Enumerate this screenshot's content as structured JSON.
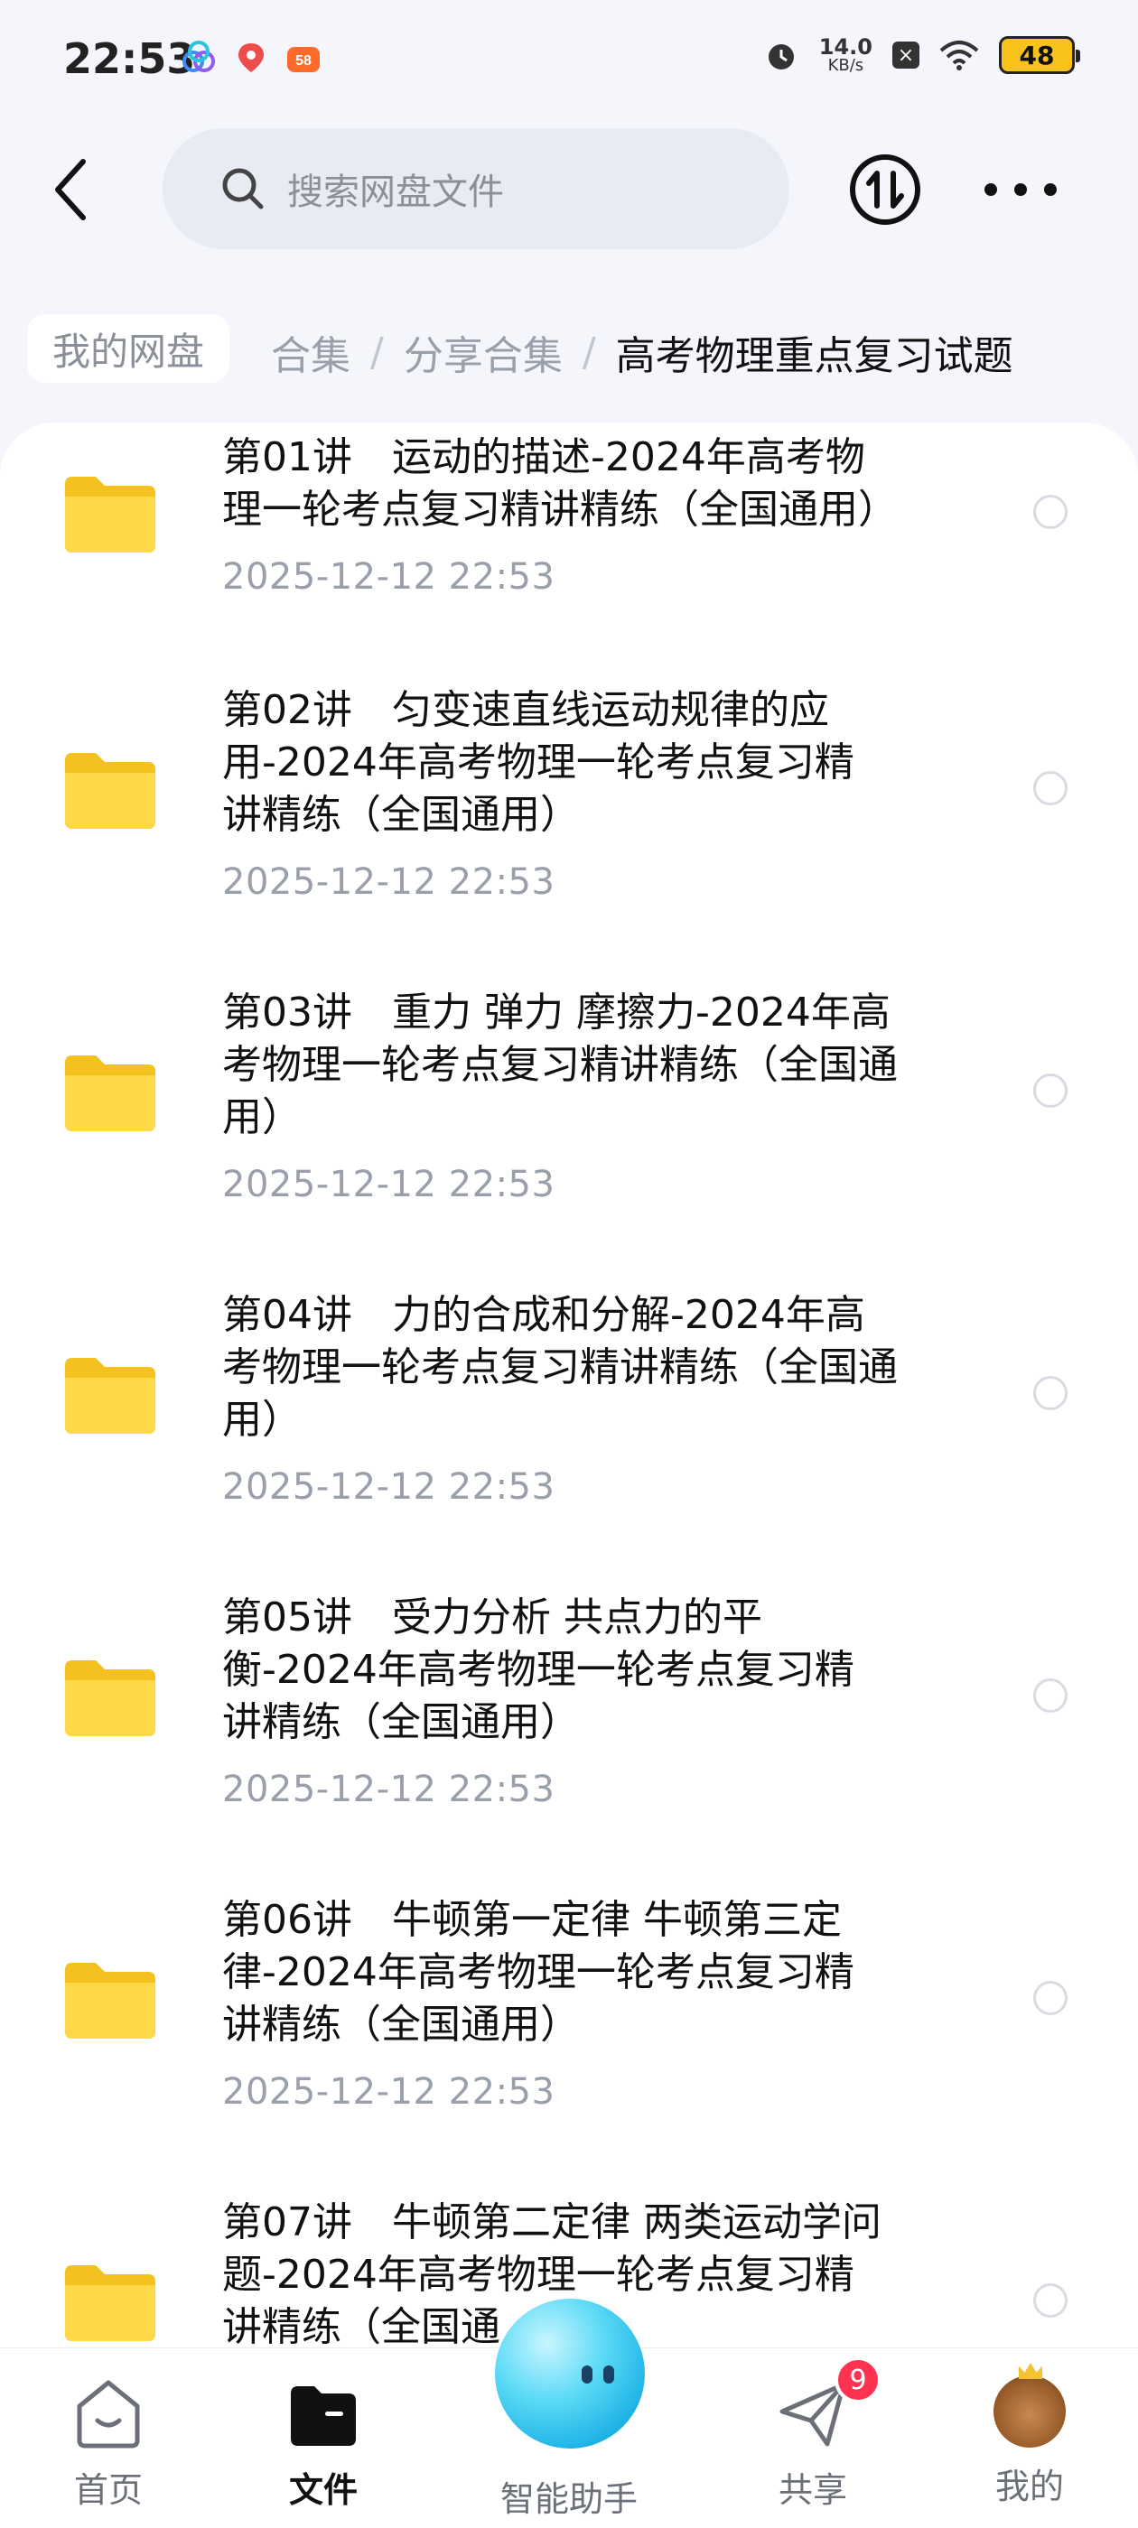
{
  "status_bar": {
    "time": "22:53",
    "net_speed_value": "14.0",
    "net_speed_unit": "KB/s",
    "battery": "48",
    "icons": [
      "app-icon-1",
      "app-icon-2",
      "app-icon-58",
      "alarm-icon",
      "signal-off-icon",
      "wifi-icon",
      "battery-icon"
    ]
  },
  "header": {
    "search_placeholder": "搜索网盘文件"
  },
  "breadcrumb": {
    "home": "我的网盘",
    "partial": "合集",
    "separator": "/",
    "middle": "分享合集",
    "current": "高考物理重点复习试题"
  },
  "files": [
    {
      "name_line1": "第01讲　运动的描述-2024年高考物",
      "name_line2": "理一轮考点复习精讲精练（全国通用）",
      "name_line3": "",
      "date": "2025-12-12  22:53"
    },
    {
      "name_line1": "第02讲　匀变速直线运动规律的应",
      "name_line2": "用-2024年高考物理一轮考点复习精",
      "name_line3": "讲精练（全国通用）",
      "date": "2025-12-12  22:53"
    },
    {
      "name_line1": "第03讲　重力 弹力 摩擦力-2024年高",
      "name_line2": "考物理一轮考点复习精讲精练（全国通",
      "name_line3": "用）",
      "date": "2025-12-12  22:53"
    },
    {
      "name_line1": "第04讲　力的合成和分解-2024年高",
      "name_line2": "考物理一轮考点复习精讲精练（全国通",
      "name_line3": "用）",
      "date": "2025-12-12  22:53"
    },
    {
      "name_line1": "第05讲　受力分析 共点力的平",
      "name_line2": "衡-2024年高考物理一轮考点复习精",
      "name_line3": "讲精练（全国通用）",
      "date": "2025-12-12  22:53"
    },
    {
      "name_line1": "第06讲　牛顿第一定律 牛顿第三定",
      "name_line2": "律-2024年高考物理一轮考点复习精",
      "name_line3": "讲精练（全国通用）",
      "date": "2025-12-12  22:53"
    },
    {
      "name_line1": "第07讲　牛顿第二定律 两类运动学问",
      "name_line2": "题-2024年高考物理一轮考点复习精",
      "name_line3": "讲精练（全国通",
      "date": ""
    }
  ],
  "bottom_nav": {
    "home": "首页",
    "files": "文件",
    "assistant": "智能助手",
    "share": "共享",
    "share_badge": "9",
    "mine": "我的"
  }
}
